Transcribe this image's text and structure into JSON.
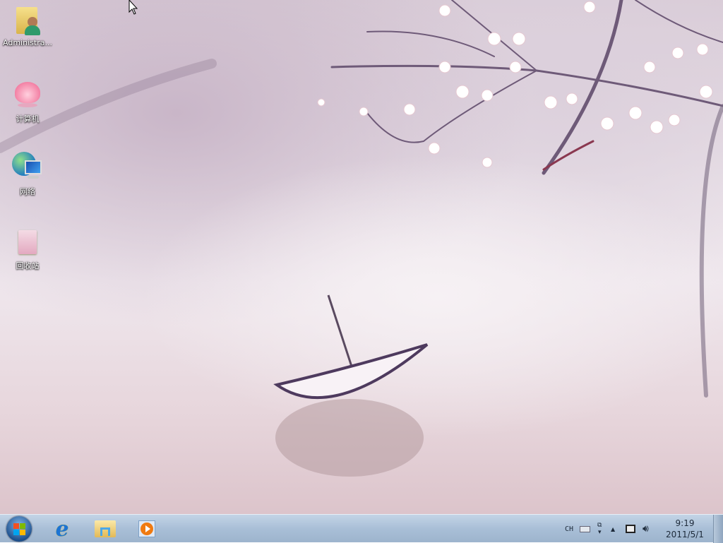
{
  "desktop": {
    "icons": [
      {
        "label": "Administra...",
        "icon": "user-folder-icon"
      },
      {
        "label": "计算机",
        "icon": "computer-lotus-icon"
      },
      {
        "label": "网络",
        "icon": "network-globe-icon"
      },
      {
        "label": "回收站",
        "icon": "recycle-bin-icon"
      }
    ]
  },
  "taskbar": {
    "pinned": [
      {
        "name": "start-button"
      },
      {
        "name": "internet-explorer"
      },
      {
        "name": "windows-explorer"
      },
      {
        "name": "windows-media-player"
      }
    ],
    "tray": {
      "language": "CH",
      "time": "9:19",
      "date": "2011/5/1"
    }
  },
  "colors": {
    "taskbar": "#a9bfd7",
    "wallpaper": "#e9e1e8"
  }
}
